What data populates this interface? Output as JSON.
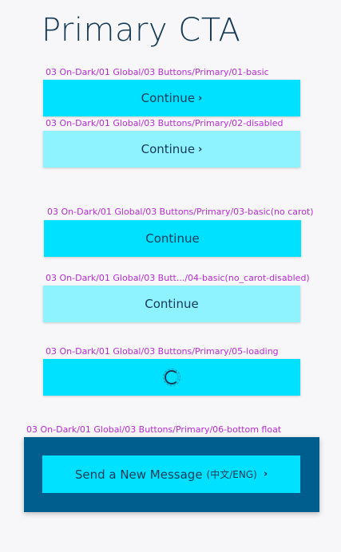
{
  "page": {
    "title": "Primary CTA"
  },
  "components": [
    {
      "label": "03 On-Dark/01 Global/03 Buttons/Primary/01-basic",
      "button_text": "Continue",
      "caret": "›"
    },
    {
      "label": "03 On-Dark/01 Global/03 Buttons/Primary/02-disabled",
      "button_text": "Continue",
      "caret": "›"
    },
    {
      "label": "03 On-Dark/01 Global/03 Buttons/Primary/03-basic(no carot)",
      "button_text": "Continue"
    },
    {
      "label": "03 On-Dark/01 Global/03 Butt.../04-basic(no_carot-disabled)",
      "button_text": "Continue"
    },
    {
      "label": "03 On-Dark/01 Global/03 Buttons/Primary/05-loading"
    },
    {
      "label": "03 On-Dark/01 Global/03 Buttons/Primary/06-bottom float",
      "button_text": "Send a New Message",
      "lang_text": "(中文/ENG)",
      "caret": "›"
    }
  ],
  "colors": {
    "primary": "#00e1ff",
    "disabled": "#8ff3ff",
    "text": "#153a55",
    "label": "#b92bd6",
    "float_panel": "#005e8e"
  },
  "icons": {
    "caret": "chevron-right-icon",
    "loading": "loading-spinner-icon"
  }
}
